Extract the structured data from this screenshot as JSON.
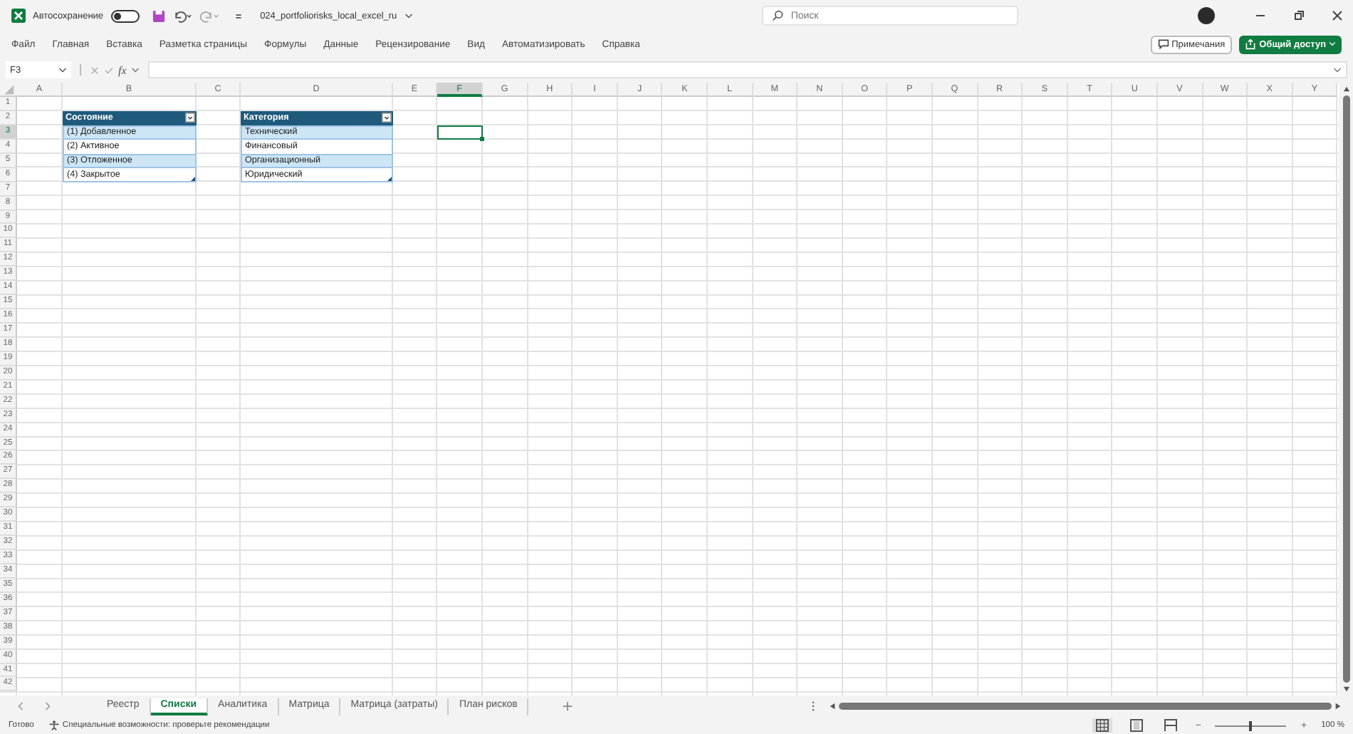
{
  "title_bar": {
    "autosave_label": "Автосохранение",
    "autosave_on": false,
    "filename": "024_portfoliorisks_local_excel_ru",
    "search_placeholder": "Поиск"
  },
  "menu": [
    {
      "label": "Файл",
      "selected": false
    },
    {
      "label": "Главная",
      "selected": false
    },
    {
      "label": "Вставка",
      "selected": false
    },
    {
      "label": "Разметка страницы",
      "selected": false
    },
    {
      "label": "Формулы",
      "selected": false
    },
    {
      "label": "Данные",
      "selected": false
    },
    {
      "label": "Рецензирование",
      "selected": false
    },
    {
      "label": "Вид",
      "selected": false
    },
    {
      "label": "Автоматизировать",
      "selected": false
    },
    {
      "label": "Справка",
      "selected": false
    }
  ],
  "ribbon_buttons": {
    "comments": "Примечания",
    "share": "Общий доступ"
  },
  "formula_bar": {
    "name_box": "F3",
    "fx": "fx"
  },
  "columns": [
    {
      "label": "A",
      "selected": false
    },
    {
      "label": "B",
      "selected": false
    },
    {
      "label": "C",
      "selected": false
    },
    {
      "label": "D",
      "selected": false
    },
    {
      "label": "E",
      "selected": false
    },
    {
      "label": "F",
      "selected": true
    },
    {
      "label": "G",
      "selected": false
    },
    {
      "label": "H",
      "selected": false
    },
    {
      "label": "I",
      "selected": false
    },
    {
      "label": "J",
      "selected": false
    },
    {
      "label": "K",
      "selected": false
    },
    {
      "label": "L",
      "selected": false
    },
    {
      "label": "M",
      "selected": false
    },
    {
      "label": "N",
      "selected": false
    },
    {
      "label": "O",
      "selected": false
    },
    {
      "label": "P",
      "selected": false
    },
    {
      "label": "Q",
      "selected": false
    },
    {
      "label": "R",
      "selected": false
    },
    {
      "label": "S",
      "selected": false
    },
    {
      "label": "T",
      "selected": false
    },
    {
      "label": "U",
      "selected": false
    },
    {
      "label": "V",
      "selected": false
    },
    {
      "label": "W",
      "selected": false
    },
    {
      "label": "X",
      "selected": false
    },
    {
      "label": "Y",
      "selected": false
    }
  ],
  "rows": [
    {
      "label": "1",
      "selected": false
    },
    {
      "label": "2",
      "selected": false
    },
    {
      "label": "3",
      "selected": true
    },
    {
      "label": "4",
      "selected": false
    },
    {
      "label": "5",
      "selected": false
    },
    {
      "label": "6",
      "selected": false
    },
    {
      "label": "7",
      "selected": false
    },
    {
      "label": "8",
      "selected": false
    },
    {
      "label": "9",
      "selected": false
    },
    {
      "label": "10",
      "selected": false
    },
    {
      "label": "11",
      "selected": false
    },
    {
      "label": "12",
      "selected": false
    },
    {
      "label": "13",
      "selected": false
    },
    {
      "label": "14",
      "selected": false
    },
    {
      "label": "15",
      "selected": false
    },
    {
      "label": "16",
      "selected": false
    },
    {
      "label": "17",
      "selected": false
    },
    {
      "label": "18",
      "selected": false
    },
    {
      "label": "19",
      "selected": false
    },
    {
      "label": "20",
      "selected": false
    },
    {
      "label": "21",
      "selected": false
    },
    {
      "label": "22",
      "selected": false
    },
    {
      "label": "23",
      "selected": false
    },
    {
      "label": "24",
      "selected": false
    },
    {
      "label": "25",
      "selected": false
    },
    {
      "label": "26",
      "selected": false
    },
    {
      "label": "27",
      "selected": false
    },
    {
      "label": "28",
      "selected": false
    },
    {
      "label": "29",
      "selected": false
    },
    {
      "label": "30",
      "selected": false
    },
    {
      "label": "31",
      "selected": false
    },
    {
      "label": "32",
      "selected": false
    },
    {
      "label": "33",
      "selected": false
    },
    {
      "label": "34",
      "selected": false
    },
    {
      "label": "35",
      "selected": false
    },
    {
      "label": "36",
      "selected": false
    },
    {
      "label": "37",
      "selected": false
    },
    {
      "label": "38",
      "selected": false
    },
    {
      "label": "39",
      "selected": false
    },
    {
      "label": "40",
      "selected": false
    },
    {
      "label": "41",
      "selected": false
    },
    {
      "label": "42",
      "selected": false
    }
  ],
  "tables": [
    {
      "header": "Состояние",
      "rows": [
        "(1) Добавленное",
        "(2) Активное",
        "(3) Отложенное",
        "(4) Закрытое"
      ]
    },
    {
      "header": "Категория",
      "rows": [
        "Технический",
        "Финансовый",
        "Организационный",
        "Юридический"
      ]
    }
  ],
  "sheet_tabs": [
    {
      "label": "Реестр",
      "selected": false
    },
    {
      "label": "Списки",
      "selected": true
    },
    {
      "label": "Аналитика",
      "selected": false
    },
    {
      "label": "Матрица",
      "selected": false
    },
    {
      "label": "Матрица (затраты)",
      "selected": false
    },
    {
      "label": "План рисков",
      "selected": false
    }
  ],
  "status_bar": {
    "ready": "Готово",
    "accessibility": "Специальные возможности: проверьте рекомендации",
    "zoom": "100 %",
    "zoom_out": "−",
    "zoom_in": "+",
    "zoom_slider": {
      "level": 0.5
    },
    "views": [
      {
        "selected": true
      },
      {
        "selected": false
      },
      {
        "selected": false
      }
    ]
  }
}
